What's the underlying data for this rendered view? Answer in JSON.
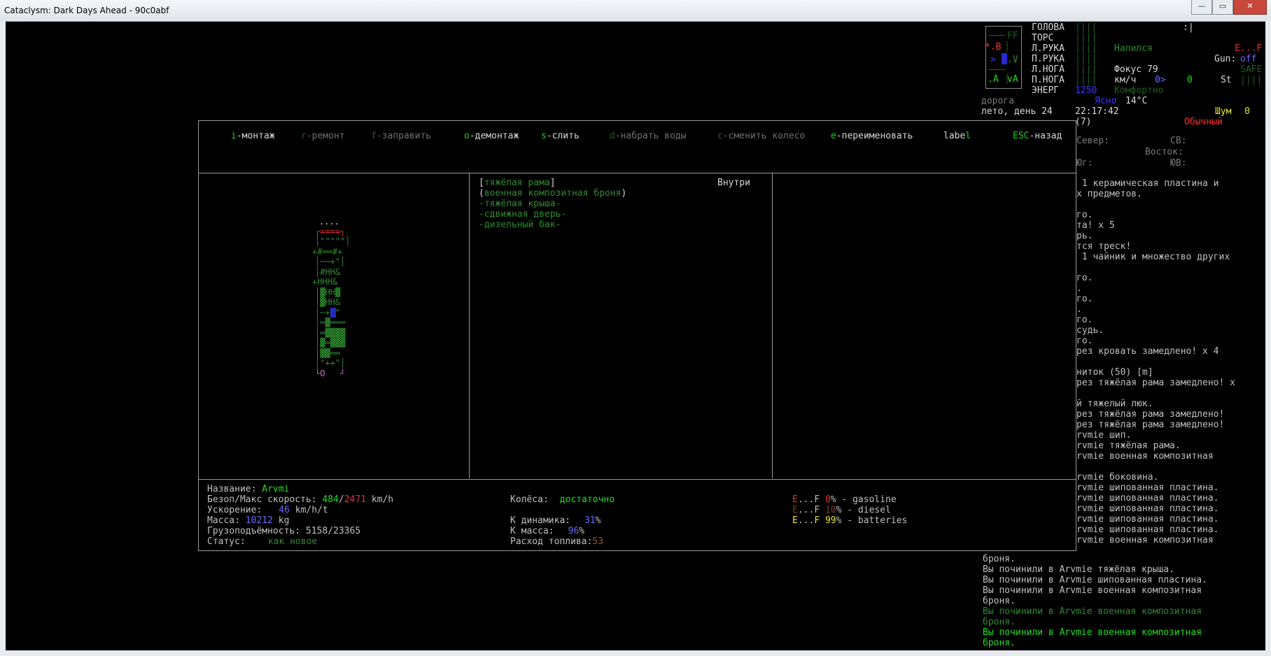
{
  "window": {
    "title": "Cataclysm: Dark Days Ahead - 90c0abf",
    "min": "—",
    "max": "▭",
    "close": "✕"
  },
  "menu": [
    {
      "key": "i",
      "label": "-монтаж",
      "enabled": true
    },
    {
      "key": "r",
      "label": "-ремонт",
      "enabled": false
    },
    {
      "key": "f",
      "label": "-заправить",
      "enabled": false
    },
    {
      "key": "o",
      "label": "-демонтаж",
      "enabled": true
    },
    {
      "key": "s",
      "label": "-слить",
      "enabled": true
    },
    {
      "key": "d",
      "label": "-набрать воды",
      "enabled": false
    },
    {
      "key": "c",
      "label": "-сменить колесо",
      "enabled": false
    },
    {
      "key": "e",
      "label": "-переименовать",
      "enabled": true
    },
    {
      "key": "l",
      "label": "abel",
      "enabled": true
    },
    {
      "key": "ESC",
      "label": "-назад",
      "enabled": true
    }
  ],
  "parts": {
    "location": "Внутри",
    "items": [
      {
        "prefix": "[",
        "name": "тяжёлая рама",
        "suffix": "]",
        "color": "#2e8b2e"
      },
      {
        "prefix": "(",
        "name": "военная композитная броня",
        "suffix": ")",
        "color": "#2e8b2e"
      },
      {
        "prefix": "-",
        "name": "тяжёлая крыша",
        "suffix": "-",
        "color": "#2e8b2e"
      },
      {
        "prefix": "-",
        "name": "сдвижная дверь",
        "suffix": "-",
        "color": "#2e8b2e"
      },
      {
        "prefix": "-",
        "name": "дизельный бак",
        "suffix": "-",
        "color": "#2e8b2e"
      }
    ]
  },
  "vehicle_map": {
    "rows": [
      "....",
      "┌====┐",
      "│\"\"\"\"\"│",
      "+#══#+",
      "│──+\"│",
      "│#HH&",
      "+HHH&",
      "│▓HH▓",
      "│▓HH&",
      "│─+@\"",
      "│═▓═══",
      "│═▓▓▓▓",
      "│▓═▓▓▓",
      "│▓▓══",
      "│\"++\"│",
      "└O   ┘"
    ]
  },
  "info": {
    "name_label": "Название: ",
    "name_value": "Arvmi",
    "speed_label": "Безоп/Макс скорость: ",
    "speed_safe": "484",
    "speed_sep": "/",
    "speed_max": "2471",
    "speed_unit": " km/h",
    "accel_label": "Ускорение:",
    "accel_value": "46",
    "accel_unit": " km/h/t",
    "mass_label": "Масса: ",
    "mass_value": "10212",
    "mass_unit": " kg",
    "cargo_label": "Грузоподъёмность: ",
    "cargo_value": "5158/23365",
    "status_label": "Статус:",
    "status_value": "как новое",
    "wheels_label": "Колёса:",
    "wheels_value": "достаточно",
    "kdyn_label": "К динамика:",
    "kdyn_value": "31",
    "kdyn_pct": "%",
    "kmass_label": "К масса:",
    "kmass_value": "96",
    "kmass_pct": "%",
    "fuel_label": "Расход топлива:",
    "fuel_value": "53",
    "tanks": [
      {
        "e": "E",
        "dots": "...",
        "f": "F",
        "pct": "0",
        "name": "% - gasoline",
        "ecolor": "#e03030",
        "pcolor": "#e03030"
      },
      {
        "e": "E",
        "dots": "...",
        "f": "F",
        "pct": "10",
        "name": "% - diesel",
        "ecolor": "#7a3a2a",
        "pcolor": "#7a3a2a"
      },
      {
        "e": "E",
        "dots": "...",
        "f": "F",
        "pct": "99",
        "name": "% - batteries",
        "ecolor": "#e8e820",
        "pcolor": "#e8e820"
      }
    ]
  },
  "sidebar": {
    "body": [
      {
        "part": "ГОЛОВА",
        "bar": "||||"
      },
      {
        "part": "ТОРС",
        "bar": "||||"
      },
      {
        "part": "Л.РУКА",
        "bar": "||||"
      },
      {
        "part": "П.РУКА",
        "bar": "||||"
      },
      {
        "part": "Л.НОГА",
        "bar": "||||"
      },
      {
        "part": "П.НОГА",
        "bar": "||||"
      },
      {
        "part": "ЭНЕРГ",
        "bar": "1250"
      }
    ],
    "thirst": "Напился",
    "fuel_ef": "E...F",
    "gun_label": "Gun:",
    "gun_value": "off",
    "focus": "Фокус 79",
    "safe": "SAFE",
    "speed_unit": "км/ч",
    "speed_zero": "0>",
    "speed_val": "0",
    "st": "St",
    "st_bar": "||||",
    "comfort": "Комфортно",
    "cursor": ":|",
    "minimap": {
      "ff": "FF",
      "b": "*.B",
      "v": ".V",
      "a": ".A",
      "va": "vA",
      "arrow": ">"
    },
    "terrain": "дорога",
    "weather": "Ясно",
    "temp": "14°C",
    "date": "лето, день 24",
    "time": "22:17:42",
    "noise_label": "Шум",
    "noise_value": "0",
    "moves": "(7)",
    "mode": "Обычный",
    "compass": {
      "n": "Север:",
      "ne": "СВ:",
      "e": "Восток:",
      "s": "Юг:",
      "se": "ЮВ:"
    }
  },
  "log": [
    {
      "text": " 1 керамическая пластина и",
      "color": "#c0c0c0"
    },
    {
      "text": "х предметов.",
      "color": "#c0c0c0"
    },
    {
      "text": "",
      "color": "#c0c0c0"
    },
    {
      "text": "го.",
      "color": "#c0c0c0"
    },
    {
      "text": "та! x 5",
      "color": "#c0c0c0"
    },
    {
      "text": "рь.",
      "color": "#c0c0c0"
    },
    {
      "text": "тся треск!",
      "color": "#c0c0c0"
    },
    {
      "text": " 1 чайник и множество других",
      "color": "#c0c0c0"
    },
    {
      "text": "",
      "color": "#c0c0c0"
    },
    {
      "text": "",
      "color": "#c0c0c0"
    },
    {
      "text": "го.",
      "color": "#c0c0c0"
    },
    {
      "text": ".",
      "color": "#c0c0c0"
    },
    {
      "text": "го.",
      "color": "#c0c0c0"
    },
    {
      "text": ".",
      "color": "#c0c0c0"
    },
    {
      "text": "го.",
      "color": "#c0c0c0"
    },
    {
      "text": "судь.",
      "color": "#c0c0c0"
    },
    {
      "text": "го.",
      "color": "#c0c0c0"
    },
    {
      "text": "рез кровать замедлено! x 4",
      "color": "#c0c0c0"
    },
    {
      "text": "",
      "color": "#c0c0c0"
    },
    {
      "text": "ниток (50) [m]",
      "color": "#c0c0c0"
    },
    {
      "text": "рез тяжёлая рама замедлено! x",
      "color": "#c0c0c0"
    },
    {
      "text": "",
      "color": "#c0c0c0"
    },
    {
      "text": "й тяжелый люк.",
      "color": "#c0c0c0"
    },
    {
      "text": "рез тяжёлая рама замедлено!",
      "color": "#c0c0c0"
    },
    {
      "text": "рез тяжёлая рама замедлено!",
      "color": "#c0c0c0"
    },
    {
      "text": "rvmie шип.",
      "color": "#c0c0c0"
    },
    {
      "text": "rvmie тяжёлая рама.",
      "color": "#c0c0c0"
    },
    {
      "text": "rvmie военная композитная",
      "color": "#c0c0c0"
    },
    {
      "text": "",
      "color": "#c0c0c0"
    },
    {
      "text": "rvmie боковина.",
      "color": "#c0c0c0"
    },
    {
      "text": "rvmie шипованная пластина.",
      "color": "#c0c0c0"
    },
    {
      "text": "rvmie шипованная пластина.",
      "color": "#c0c0c0"
    },
    {
      "text": "rvmie шипованная пластина.",
      "color": "#c0c0c0"
    },
    {
      "text": "rvmie шипованная пластина.",
      "color": "#c0c0c0"
    },
    {
      "text": "rvmie шипованная пластина.",
      "color": "#c0c0c0"
    },
    {
      "text": "rvmie военная композитная",
      "color": "#c0c0c0"
    }
  ],
  "log_bottom": [
    {
      "text": "броня.",
      "color": "#c0c0c0"
    },
    {
      "text": "Вы починили в Arvmie тяжёлая крыша.",
      "color": "#c0c0c0"
    },
    {
      "text": "Вы починили в Arvmie шипованная пластина.",
      "color": "#c0c0c0"
    },
    {
      "text": "Вы починили в Arvmie военная композитная",
      "color": "#c0c0c0"
    },
    {
      "text": "броня.",
      "color": "#c0c0c0"
    },
    {
      "text": "Вы починили в Arvmie военная композитная",
      "color": "#2e8b2e"
    },
    {
      "text": "броня.",
      "color": "#2e8b2e"
    },
    {
      "text": "Вы починили в Arvmie военная композитная",
      "color": "#22dd22"
    },
    {
      "text": "броня.",
      "color": "#22dd22"
    }
  ]
}
